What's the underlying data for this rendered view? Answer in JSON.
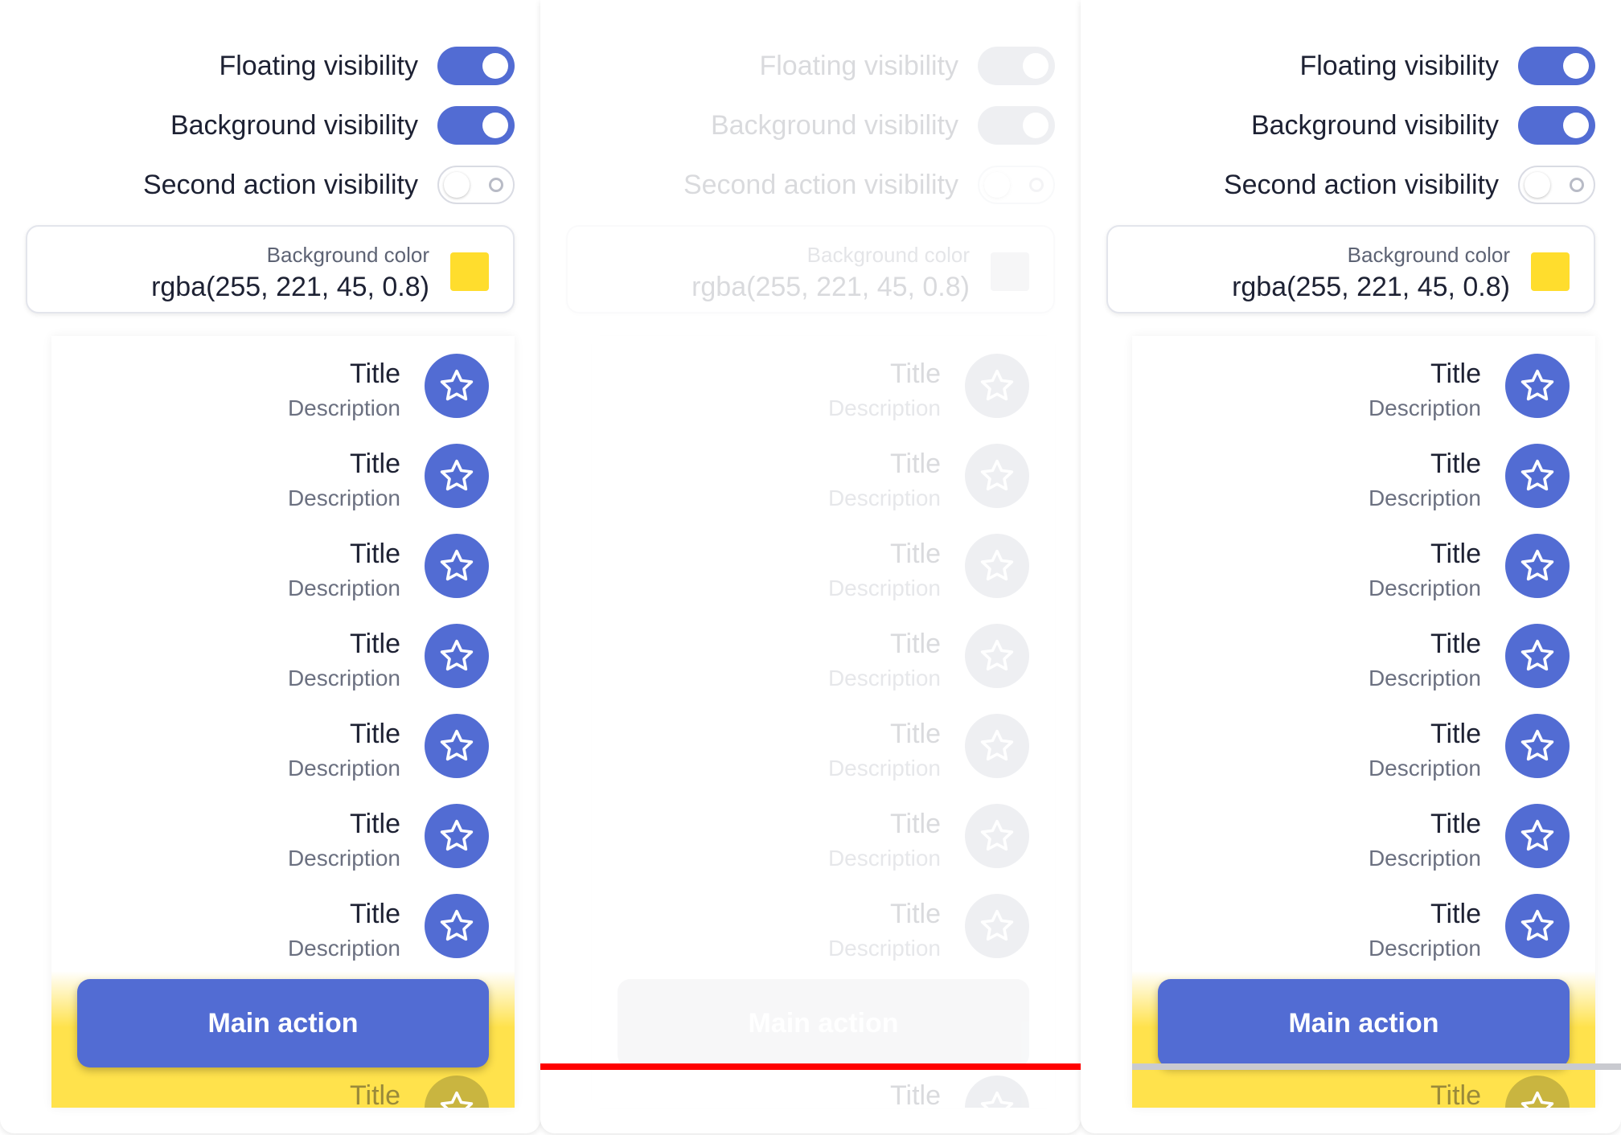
{
  "colors": {
    "accent": "#526cd3",
    "background_swatch": "#ffdd2d",
    "text": "#1d2133",
    "muted_text": "#6b7080",
    "error_line": "#ff0000"
  },
  "panels": [
    {
      "state": "enabled",
      "toggles": [
        {
          "label": "Floating visibility",
          "on": true
        },
        {
          "label": "Background visibility",
          "on": true
        },
        {
          "label": "Second action visibility",
          "on": false
        }
      ],
      "background_color": {
        "label": "Background color",
        "value": "rgba(255, 221, 45, 0.8)"
      },
      "items": [
        {
          "title": "Title",
          "description": "Description",
          "icon": "star-icon"
        },
        {
          "title": "Title",
          "description": "Description",
          "icon": "star-icon"
        },
        {
          "title": "Title",
          "description": "Description",
          "icon": "star-icon"
        },
        {
          "title": "Title",
          "description": "Description",
          "icon": "star-icon"
        },
        {
          "title": "Title",
          "description": "Description",
          "icon": "star-icon"
        },
        {
          "title": "Title",
          "description": "Description",
          "icon": "star-icon"
        },
        {
          "title": "Title",
          "description": "Description",
          "icon": "star-icon"
        },
        {
          "title": "Title",
          "description": "",
          "icon": "star-icon"
        }
      ],
      "main_action": "Main action"
    },
    {
      "state": "disabled",
      "toggles": [
        {
          "label": "Floating visibility",
          "on": true
        },
        {
          "label": "Background visibility",
          "on": true
        },
        {
          "label": "Second action visibility",
          "on": false
        }
      ],
      "background_color": {
        "label": "Background color",
        "value": "rgba(255, 221, 45, 0.8)"
      },
      "items": [
        {
          "title": "Title",
          "description": "Description",
          "icon": "star-icon"
        },
        {
          "title": "Title",
          "description": "Description",
          "icon": "star-icon"
        },
        {
          "title": "Title",
          "description": "Description",
          "icon": "star-icon"
        },
        {
          "title": "Title",
          "description": "Description",
          "icon": "star-icon"
        },
        {
          "title": "Title",
          "description": "Description",
          "icon": "star-icon"
        },
        {
          "title": "Title",
          "description": "Description",
          "icon": "star-icon"
        },
        {
          "title": "Title",
          "description": "Description",
          "icon": "star-icon"
        },
        {
          "title": "Title",
          "description": "",
          "icon": "star-icon"
        }
      ],
      "main_action": "Main action"
    },
    {
      "state": "enabled",
      "toggles": [
        {
          "label": "Floating visibility",
          "on": true
        },
        {
          "label": "Background visibility",
          "on": true
        },
        {
          "label": "Second action visibility",
          "on": false
        }
      ],
      "background_color": {
        "label": "Background color",
        "value": "rgba(255, 221, 45, 0.8)"
      },
      "items": [
        {
          "title": "Title",
          "description": "Description",
          "icon": "star-icon"
        },
        {
          "title": "Title",
          "description": "Description",
          "icon": "star-icon"
        },
        {
          "title": "Title",
          "description": "Description",
          "icon": "star-icon"
        },
        {
          "title": "Title",
          "description": "Description",
          "icon": "star-icon"
        },
        {
          "title": "Title",
          "description": "Description",
          "icon": "star-icon"
        },
        {
          "title": "Title",
          "description": "Description",
          "icon": "star-icon"
        },
        {
          "title": "Title",
          "description": "Description",
          "icon": "star-icon"
        },
        {
          "title": "Title",
          "description": "",
          "icon": "star-icon"
        }
      ],
      "main_action": "Main action"
    }
  ]
}
